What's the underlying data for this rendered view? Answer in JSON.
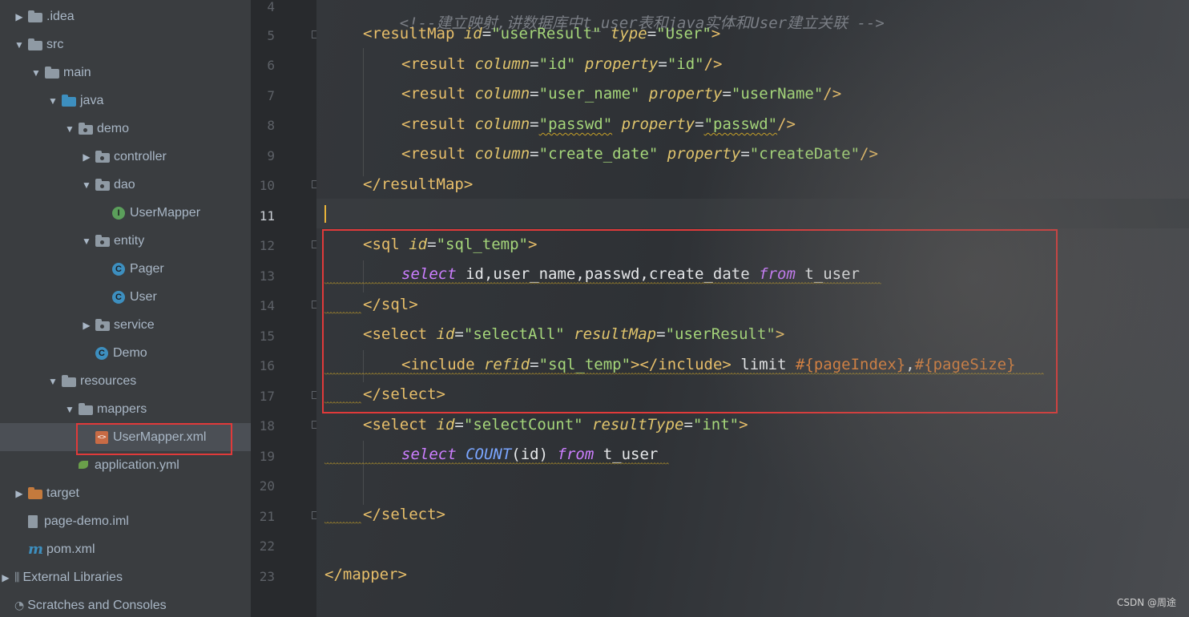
{
  "tree": [
    {
      "label": ".idea",
      "indent": 0,
      "arrow": "right",
      "icon": "folder"
    },
    {
      "label": "src",
      "indent": 0,
      "arrow": "down",
      "icon": "folder"
    },
    {
      "label": "main",
      "indent": 1,
      "arrow": "down",
      "icon": "folder"
    },
    {
      "label": "java",
      "indent": 2,
      "arrow": "down",
      "icon": "folder-blue"
    },
    {
      "label": "demo",
      "indent": 3,
      "arrow": "down",
      "icon": "package"
    },
    {
      "label": "controller",
      "indent": 4,
      "arrow": "right",
      "icon": "package"
    },
    {
      "label": "dao",
      "indent": 4,
      "arrow": "down",
      "icon": "package"
    },
    {
      "label": "UserMapper",
      "indent": 5,
      "arrow": "none",
      "icon": "interface"
    },
    {
      "label": "entity",
      "indent": 4,
      "arrow": "down",
      "icon": "package"
    },
    {
      "label": "Pager",
      "indent": 5,
      "arrow": "none",
      "icon": "class"
    },
    {
      "label": "User",
      "indent": 5,
      "arrow": "none",
      "icon": "class"
    },
    {
      "label": "service",
      "indent": 4,
      "arrow": "right",
      "icon": "package"
    },
    {
      "label": "Demo",
      "indent": 4,
      "arrow": "none",
      "icon": "spring-class"
    },
    {
      "label": "resources",
      "indent": 2,
      "arrow": "down",
      "icon": "resources-folder"
    },
    {
      "label": "mappers",
      "indent": 3,
      "arrow": "down",
      "icon": "folder"
    },
    {
      "label": "UserMapper.xml",
      "indent": 4,
      "arrow": "none",
      "icon": "xml-file",
      "selected": true
    },
    {
      "label": "application.yml",
      "indent": 3,
      "arrow": "none",
      "icon": "yml-file"
    },
    {
      "label": "target",
      "indent": 0,
      "arrow": "right",
      "icon": "folder-orange"
    },
    {
      "label": "page-demo.iml",
      "indent": 0,
      "arrow": "none",
      "icon": "iml-file"
    },
    {
      "label": "pom.xml",
      "indent": 0,
      "arrow": "none",
      "icon": "maven-file"
    },
    {
      "label": "External Libraries",
      "indent": -1,
      "arrow": "right",
      "icon": "library"
    },
    {
      "label": "Scratches and Consoles",
      "indent": -1,
      "arrow": "none",
      "icon": "scratches"
    }
  ],
  "line_numbers": [
    "4",
    "5",
    "6",
    "7",
    "8",
    "9",
    "10",
    "11",
    "12",
    "13",
    "14",
    "15",
    "16",
    "17",
    "18",
    "19",
    "20",
    "21",
    "22",
    "23"
  ],
  "current_line": "11",
  "code": {
    "l4": {
      "comment": "<!--建立映射,讲数据库中t_user表和java实体和User建立关联 -->"
    },
    "l5": {
      "open": "<resultMap",
      "a1": "id",
      "v1": "\"userResult\"",
      "a2": "type",
      "v2": "\"User\"",
      "close": ">"
    },
    "l6": {
      "open": "<result",
      "a1": "column",
      "v1": "\"id\"",
      "a2": "property",
      "v2": "\"id\"",
      "close": "/>"
    },
    "l7": {
      "open": "<result",
      "a1": "column",
      "v1": "\"user_name\"",
      "a2": "property",
      "v2": "\"userName\"",
      "close": "/>"
    },
    "l8": {
      "open": "<result",
      "a1": "column",
      "v1": "\"passwd\"",
      "a2": "property",
      "v2": "\"passwd\"",
      "close": "/>"
    },
    "l9": {
      "open": "<result",
      "a1": "column",
      "v1": "\"create_date\"",
      "a2": "property",
      "v2": "\"createDate\"",
      "close": "/>"
    },
    "l10": {
      "tag": "</resultMap>"
    },
    "l12": {
      "open": "<sql",
      "a1": "id",
      "v1": "\"sql_temp\"",
      "close": ">"
    },
    "l13": {
      "kw1": "select",
      "txt": " id,user_name,passwd,create_date ",
      "kw2": "from",
      "txt2": " t_user"
    },
    "l14": {
      "tag": "</sql>"
    },
    "l15": {
      "open": "<select",
      "a1": "id",
      "v1": "\"selectAll\"",
      "a2": "resultMap",
      "v2": "\"userResult\"",
      "close": ">"
    },
    "l16": {
      "open": "<include",
      "a1": "refid",
      "v1": "\"sql_temp\"",
      "mid": "></",
      "tag2": "include",
      "close": ">",
      "txt": " limit ",
      "p1": "#{pageIndex}",
      "comma": ",",
      "p2": "#{pageSize}"
    },
    "l17": {
      "tag": "</select>"
    },
    "l18": {
      "open": "<select",
      "a1": "id",
      "v1": "\"selectCount\"",
      "a2": "resultType",
      "v2": "\"int\"",
      "close": ">"
    },
    "l19": {
      "kw1": "select",
      "fn": "COUNT",
      "args": "(id) ",
      "kw2": "from",
      "txt2": " t_user"
    },
    "l21": {
      "tag": "</select>"
    },
    "l23": {
      "tag": "</mapper>"
    }
  },
  "watermark": "CSDN @周途",
  "colors": {
    "highlight_box": "#e03a3a",
    "tag": "#e8bf6a",
    "attr": "#e0c46c",
    "value": "#a5d67a",
    "keyword": "#cc7eff"
  }
}
